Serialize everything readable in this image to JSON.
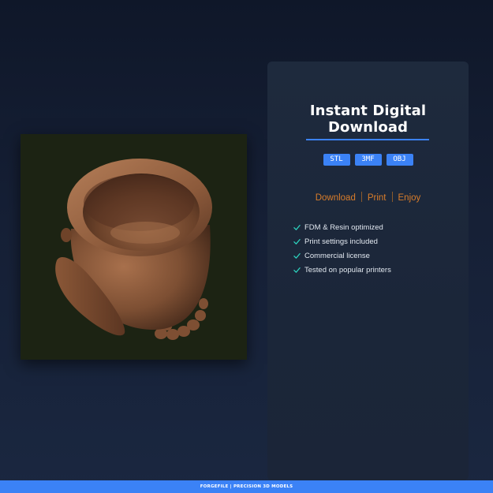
{
  "product": {
    "image_subject": "3D printed cauldron model"
  },
  "panel": {
    "title_line1": "Instant Digital",
    "title_line2": "Download",
    "formats": [
      "STL",
      "3MF",
      "OBJ"
    ],
    "tagline": {
      "download": "Download",
      "print": "Print",
      "enjoy": "Enjoy"
    },
    "features": [
      "FDM & Resin optimized",
      "Print settings included",
      "Commercial license",
      "Tested on popular printers"
    ]
  },
  "footer": {
    "text": "FORGEFILE | PRECISION 3D MODELS"
  },
  "colors": {
    "accent": "#3b82f6",
    "tagline": "#d97d2a",
    "check": "#2dd4bf",
    "background": "#131d31"
  },
  "icons": {
    "check": "check-icon"
  }
}
